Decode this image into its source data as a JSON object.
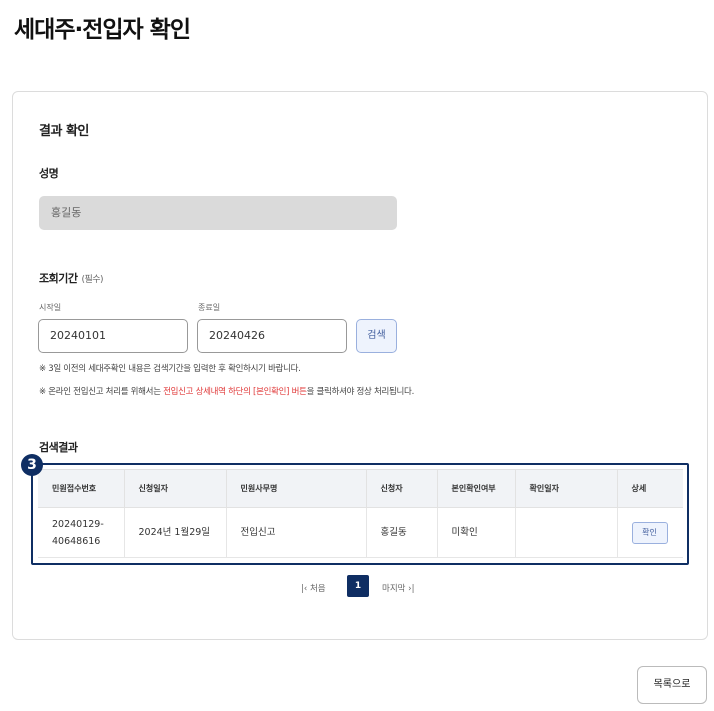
{
  "page": {
    "title": "세대주·전입자 확인"
  },
  "form": {
    "section_title": "결과 확인",
    "name_label": "성명",
    "name_value": "홍길동",
    "period_label": "조회기간",
    "period_required": "(필수)",
    "start_label": "시작일",
    "start_value": "20240101",
    "end_label": "종료일",
    "end_value": "20240426",
    "search_label": "검색",
    "note1": "※ 3일 이전의 세대주확인 내용은 검색기간을 입력한 후 확인하시기 바랍니다.",
    "note2_pre": "※ 온라인 전입신고 처리를 위해서는 ",
    "note2_red": "전입신고 상세내역 하단의 [본인확인] 버튼",
    "note2_post": "을 클릭하셔야 정상 처리됩니다."
  },
  "results": {
    "title": "검색결과",
    "marker": "3",
    "columns": [
      "민원접수번호",
      "신청일자",
      "민원사무명",
      "신청자",
      "본인확인여부",
      "확인일자",
      "상세"
    ],
    "rows": [
      {
        "receipt_no_line1": "20240129-",
        "receipt_no_line2": "40648616",
        "apply_date": "2024년 1월29일",
        "service": "전입신고",
        "applicant": "홍길동",
        "verified": "미확인",
        "confirm_date": "",
        "detail_button": "확인"
      }
    ]
  },
  "pagination": {
    "first_label": "처음",
    "current_page": "1",
    "last_label": "마지막"
  },
  "footer": {
    "list_button": "목록으로"
  }
}
